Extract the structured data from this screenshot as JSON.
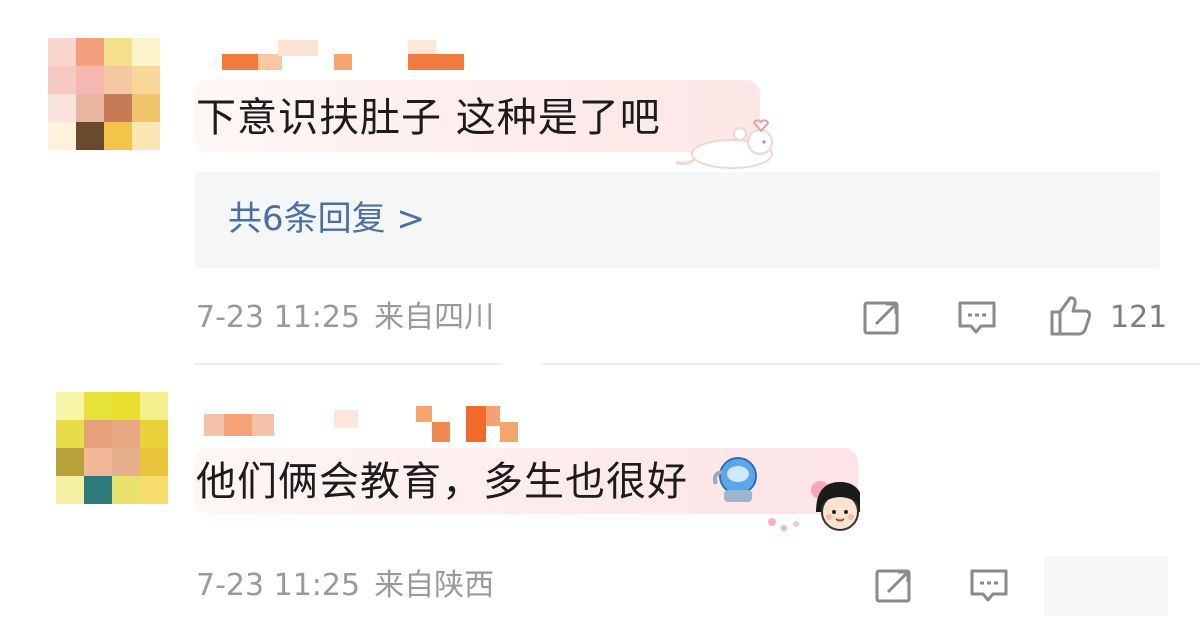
{
  "comments": [
    {
      "text": "下意识扶肚子 这种是了吧",
      "replies_label": "共6条回复 >",
      "date": "7-23 11:25",
      "location": "来自四川",
      "like_count": "121"
    },
    {
      "text": "他们俩会教育，多生也很好",
      "date": "7-23 11:25",
      "location": "来自陕西"
    }
  ],
  "icons": {
    "share": "share-icon",
    "comment": "comment-icon",
    "like": "thumbs-up-icon"
  },
  "colors": {
    "link": "#4a6fa5",
    "meta": "#9a9a9a",
    "reply_bg": "#f5f6f8"
  }
}
